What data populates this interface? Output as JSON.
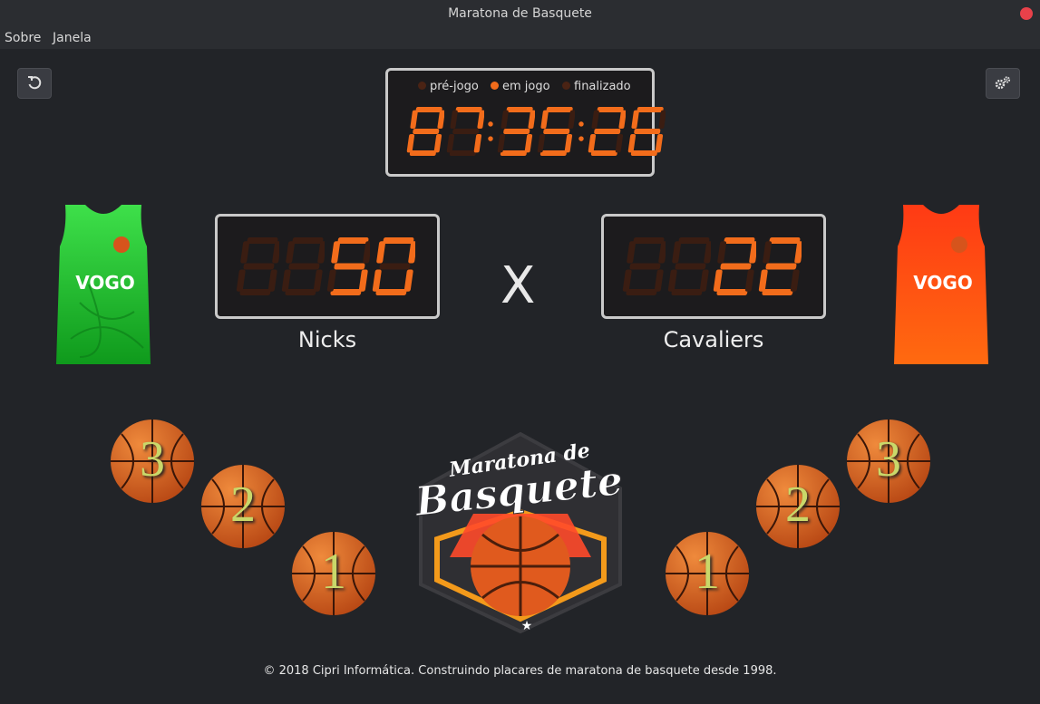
{
  "window": {
    "title": "Maratona de Basquete"
  },
  "menu": {
    "items": [
      "Sobre",
      "Janela"
    ]
  },
  "toolbar": {
    "reset_icon": "undo-icon",
    "settings_icon": "gears-icon"
  },
  "clock": {
    "states": [
      {
        "label": "pré-jogo",
        "active": false
      },
      {
        "label": "em jogo",
        "active": true
      },
      {
        "label": "finalizado",
        "active": false
      }
    ],
    "time": "87:35:26"
  },
  "home": {
    "name": "Nicks",
    "score": "50",
    "digits": 4,
    "jersey_color": "#1ec832",
    "jersey_brand": "VOGO"
  },
  "away": {
    "name": "Cavaliers",
    "score": "22",
    "digits": 4,
    "jersey_color": "#ff3a10",
    "jersey_brand": "VOGO"
  },
  "versus": "X",
  "point_buttons": [
    "3",
    "2",
    "1"
  ],
  "logo": {
    "line1": "Maratona de",
    "line2": "Basquete"
  },
  "footer": "© 2018 Cipri Informática. Construindo placares de maratona de basquete desde 1998.",
  "colors": {
    "segment_on": "#f26c1b",
    "segment_off": "#3a1d12",
    "ball": "#d65a1c",
    "ball_number": "#c9d86a"
  }
}
